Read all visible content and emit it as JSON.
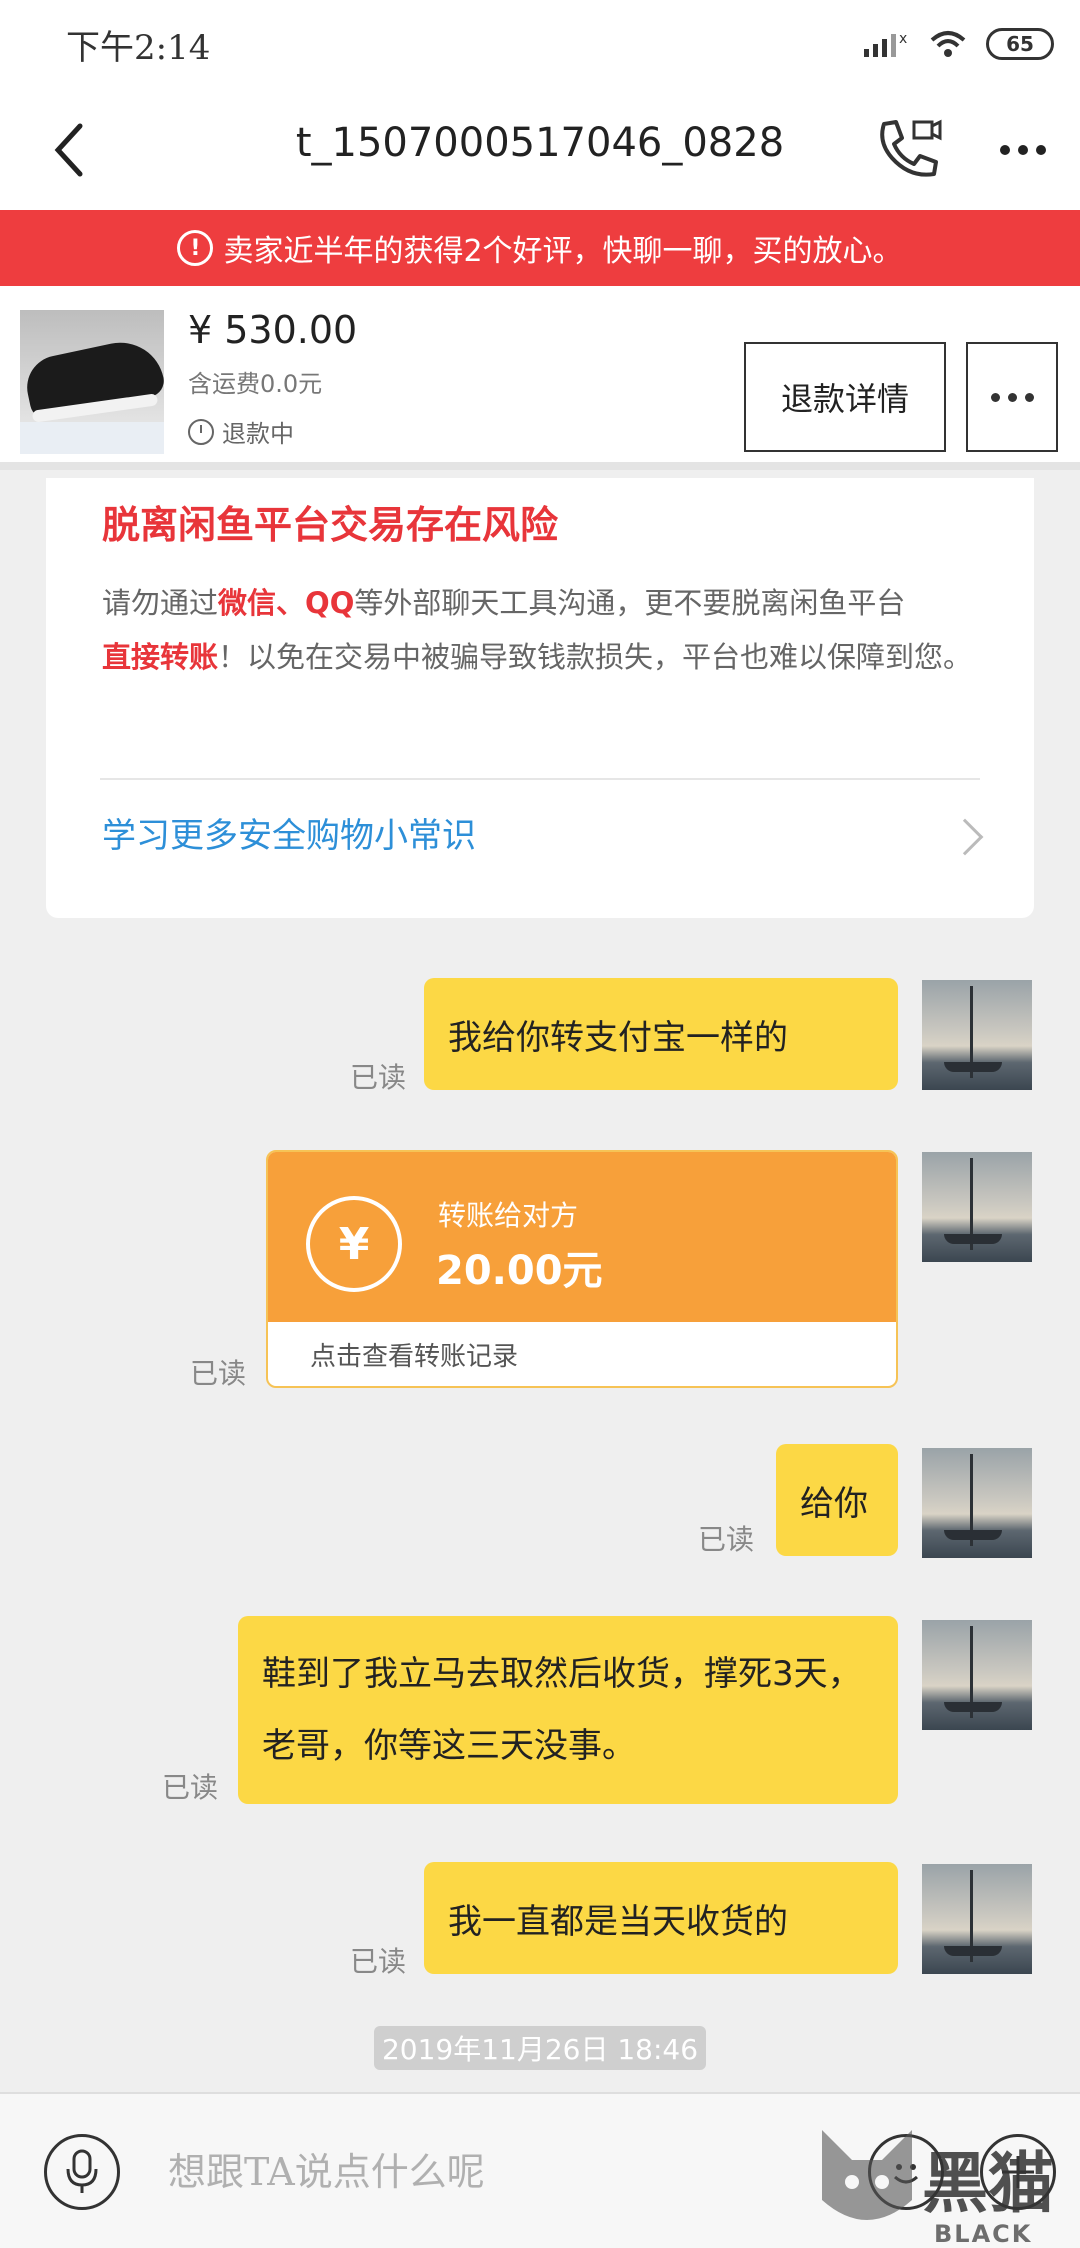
{
  "status_bar": {
    "time": "下午2:14",
    "battery": "65"
  },
  "header": {
    "title": "t_1507000517046_0828"
  },
  "banner": {
    "text": "卖家近半年的获得2个好评，快聊一聊，买的放心。"
  },
  "product": {
    "price": "¥ 530.00",
    "shipping": "含运费0.0元",
    "status": "退款中",
    "refund_button": "退款详情"
  },
  "safety": {
    "title": "脱离闲鱼平台交易存在风险",
    "body_1": "请勿通过",
    "highlight_1": "微信",
    "sep": "、",
    "highlight_2": "QQ",
    "body_2": "等外部聊天工具沟通，更不要脱离闲鱼平台",
    "highlight_3": "直接转账",
    "body_3": "！以免在交易中被骗导致钱款损失，平台也难以保障到您。",
    "link": "学习更多安全购物小常识"
  },
  "messages": [
    {
      "text": "我给你转支付宝一样的",
      "read": "已读"
    },
    {
      "read": "已读"
    },
    {
      "text": "给你",
      "read": "已读"
    },
    {
      "text": "鞋到了我立马去取然后收货，撑死3天，老哥，你等这三天没事。",
      "read": "已读"
    },
    {
      "text": "我一直都是当天收货的",
      "read": "已读"
    }
  ],
  "transfer": {
    "label": "转账给对方",
    "amount": "20.00元",
    "record": "点击查看转账记录",
    "symbol": "¥"
  },
  "timestamp": "2019年11月26日 18:46",
  "input": {
    "placeholder": "想跟TA说点什么呢"
  },
  "watermark": {
    "main": "黑猫",
    "sub": "BLACK CAT"
  },
  "colors": {
    "banner": "#ee3d3f",
    "bubble": "#fcd845",
    "transfer": "#f7a03a",
    "link": "#2d8fd8",
    "warning_text": "#e8353a"
  }
}
